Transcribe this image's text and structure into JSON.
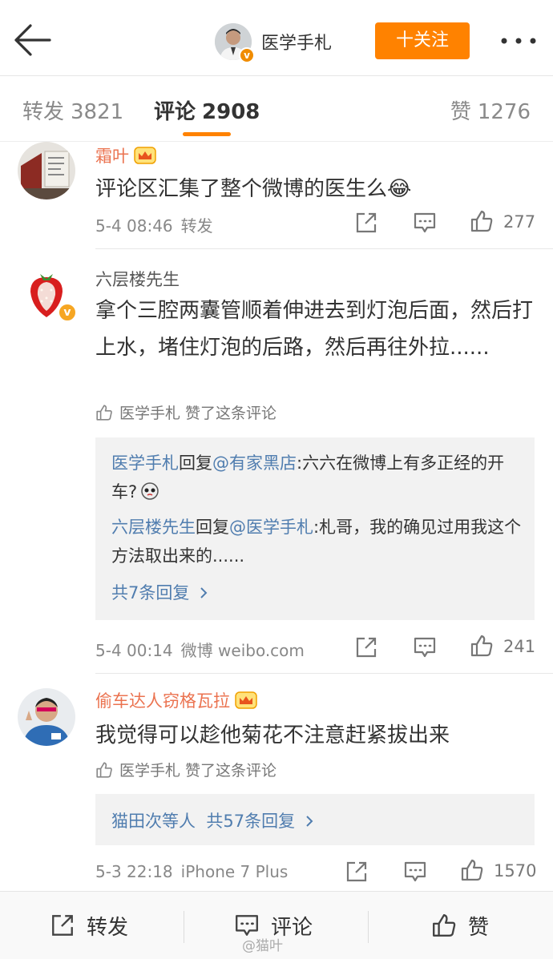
{
  "header": {
    "title": "医学手札",
    "follow_label": "十关注",
    "back_icon": "arrow-left-icon",
    "more_icon": "ellipsis-icon"
  },
  "tabs": {
    "repost_label": "转发",
    "repost_count": "3821",
    "comment_label": "评论",
    "comment_count": "2908",
    "like_label": "赞",
    "like_count": "1276"
  },
  "comments": [
    {
      "username": "霜叶",
      "text": "评论区汇集了整个微博的医生么😂",
      "time": "5-4 08:46",
      "source": "转发",
      "likes": "277"
    },
    {
      "username": "六层楼先生",
      "text": "拿个三腔两囊管顺着伸进去到灯泡后面，然后打上水，堵住灯泡的后路，然后再往外拉......",
      "liked_by": "医学手札 赞了这条评论",
      "replies": [
        {
          "from": "医学手札",
          "verb": "回复",
          "to": "@有家黑店",
          "text": ":六六在微博上有多正经的开车?"
        },
        {
          "from": "六层楼先生",
          "verb": "回复",
          "to": "@医学手札",
          "text": ":札哥，我的确见过用我这个方法取出来的......"
        }
      ],
      "more_replies": "共7条回复",
      "time": "5-4 00:14",
      "source": "微博 weibo.com",
      "likes": "241"
    },
    {
      "username": "偷车达人窃格瓦拉",
      "text": "我觉得可以趁他菊花不注意赶紧拔出来",
      "liked_by": "医学手札 赞了这条评论",
      "reply_summary_prefix": "猫田次等人",
      "reply_summary": "共57条回复",
      "time": "5-3 22:18",
      "source": "iPhone 7 Plus",
      "likes": "1570"
    }
  ],
  "bottom_bar": {
    "repost_label": "转发",
    "comment_label": "评论",
    "like_label": "赞"
  },
  "watermark": "@猫叶",
  "colors": {
    "accent_orange": "#ff8200",
    "username_orange": "#eb7350",
    "link_blue": "#507daf",
    "verified_gold": "#f6a623"
  }
}
